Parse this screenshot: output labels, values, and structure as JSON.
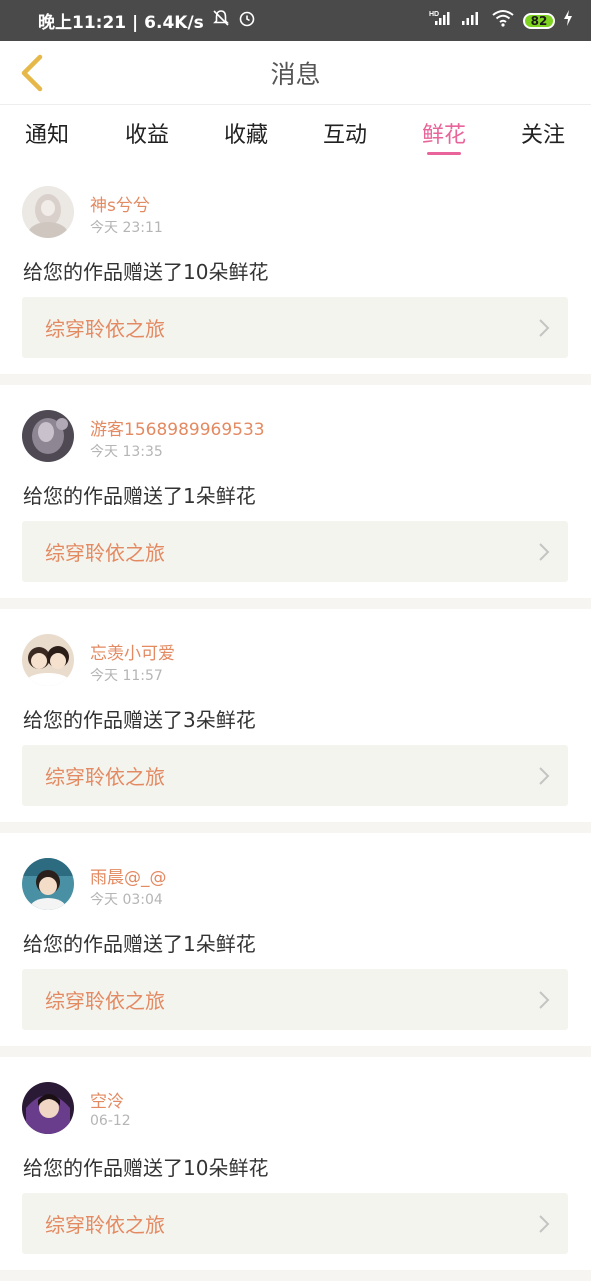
{
  "status_bar": {
    "time_speed": "晚上11:21 | 6.4K/s",
    "battery": "82",
    "hd_label": "HD"
  },
  "header": {
    "title": "消息"
  },
  "tabs": [
    {
      "label": "通知",
      "active": false
    },
    {
      "label": "收益",
      "active": false
    },
    {
      "label": "收藏",
      "active": false
    },
    {
      "label": "互动",
      "active": false
    },
    {
      "label": "鲜花",
      "active": true
    },
    {
      "label": "关注",
      "active": false
    }
  ],
  "messages": [
    {
      "username": "神s兮兮",
      "time": "今天 23:11",
      "text": "给您的作品赠送了10朵鲜花",
      "work": "综穿聆依之旅",
      "avatar_color": "#d9d0cb"
    },
    {
      "username": "游客1568989969533",
      "time": "今天 13:35",
      "text": "给您的作品赠送了1朵鲜花",
      "work": "综穿聆依之旅",
      "avatar_color": "#6b6470"
    },
    {
      "username": "忘羡小可爱",
      "time": "今天 11:57",
      "text": "给您的作品赠送了3朵鲜花",
      "work": "综穿聆依之旅",
      "avatar_color": "#c9a98c"
    },
    {
      "username": "雨晨@_@",
      "time": "今天 03:04",
      "text": "给您的作品赠送了1朵鲜花",
      "work": "综穿聆依之旅",
      "avatar_color": "#4a90a4"
    },
    {
      "username": "空泠",
      "time": "06-12",
      "text": "给您的作品赠送了10朵鲜花",
      "work": "综穿聆依之旅",
      "avatar_color": "#6a3d8c"
    }
  ],
  "colors": {
    "accent_pink": "#e8649a",
    "name_orange": "#e38a62",
    "back_arrow": "#e6b84a"
  }
}
